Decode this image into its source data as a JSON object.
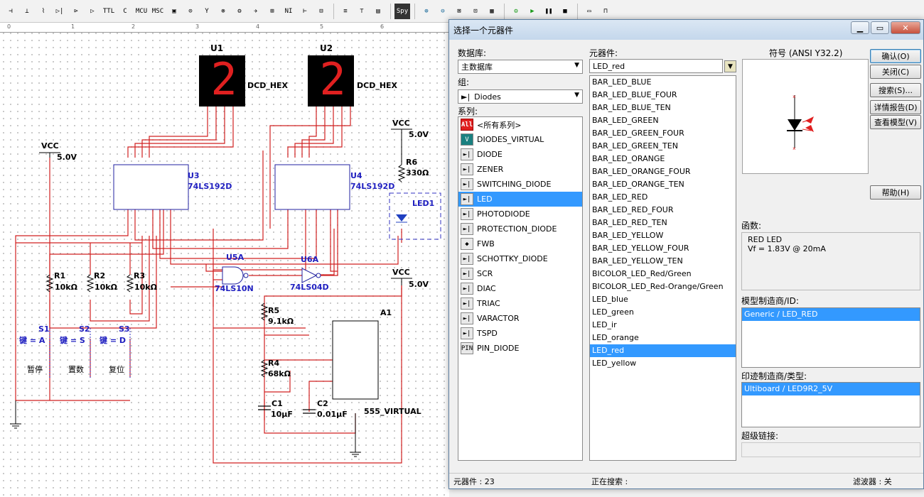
{
  "toolbar": {
    "icons": [
      "source-icon",
      "ground-icon",
      "resistor-icon",
      "diode-icon",
      "transistor-icon",
      "analog-icon",
      "ttl-icon",
      "cmos-icon",
      "mcu-icon",
      "misc-digital-icon",
      "mixed-icon",
      "indicator-icon",
      "power-icon",
      "misc-icon",
      "advanced-peripherals-icon",
      "rf-icon",
      "electromech-icon",
      "ni-component-icon",
      "connector-icon",
      "hier-block-icon",
      "bus-icon",
      "probe-icon",
      "spreadsheet-icon",
      "spy-icon",
      "zoom-in-icon",
      "zoom-out-icon",
      "zoom-area-icon",
      "zoom-fit-icon",
      "full-screen-icon",
      "run-icon",
      "play-icon",
      "pause-icon",
      "stop-icon",
      "probe-settings-icon",
      "toggle-icon"
    ],
    "spy_label": "Spy"
  },
  "schematic": {
    "u1_label": "U1",
    "u1_type": "DCD_HEX",
    "u2_label": "U2",
    "u2_type": "DCD_HEX",
    "u3_label": "U3",
    "u3_type": "74LS192D",
    "u4_label": "U4",
    "u4_type": "74LS192D",
    "u5_label": "U5A",
    "u5_type": "74LS10N",
    "u6_label": "U6A",
    "u6_type": "74LS04D",
    "a1_label": "A1",
    "a1_type": "555_VIRTUAL",
    "vcc": "VCC",
    "vcc_val": "5.0V",
    "r1": "R1",
    "r1_val": "10kΩ",
    "r2": "R2",
    "r2_val": "10kΩ",
    "r3": "R3",
    "r3_val": "10kΩ",
    "r4": "R4",
    "r4_val": "68kΩ",
    "r5": "R5",
    "r5_val": "9.1kΩ",
    "r6": "R6",
    "r6_val": "330Ω",
    "c1": "C1",
    "c1_val": "10μF",
    "c2": "C2",
    "c2_val": "0.01μF",
    "led1": "LED1",
    "s1": "S1",
    "s1_key": "键 = A",
    "s1_name": "暂停",
    "s2": "S2",
    "s2_key": "键 = S",
    "s2_name": "置数",
    "s3": "S3",
    "s3_key": "键 = D",
    "s3_name": "复位",
    "digit": "2"
  },
  "dialog": {
    "title": "选择一个元器件",
    "database_label": "数据库:",
    "database_value": "主数据库",
    "group_label": "组:",
    "group_value": "Diodes",
    "family_label": "系列:",
    "component_label": "元器件:",
    "component_input": "LED_red",
    "symbol_label": "符号 (ANSI Y32.2)",
    "families": [
      {
        "icon": "All",
        "label": "<所有系列>"
      },
      {
        "icon": "V",
        "label": "DIODES_VIRTUAL"
      },
      {
        "icon": "►|",
        "label": "DIODE"
      },
      {
        "icon": "►|",
        "label": "ZENER"
      },
      {
        "icon": "►|",
        "label": "SWITCHING_DIODE"
      },
      {
        "icon": "►|",
        "label": "LED"
      },
      {
        "icon": "►|",
        "label": "PHOTODIODE"
      },
      {
        "icon": "►|",
        "label": "PROTECTION_DIODE"
      },
      {
        "icon": "◆",
        "label": "FWB"
      },
      {
        "icon": "►|",
        "label": "SCHOTTKY_DIODE"
      },
      {
        "icon": "►|",
        "label": "SCR"
      },
      {
        "icon": "►|",
        "label": "DIAC"
      },
      {
        "icon": "►|",
        "label": "TRIAC"
      },
      {
        "icon": "►|",
        "label": "VARACTOR"
      },
      {
        "icon": "►|",
        "label": "TSPD"
      },
      {
        "icon": "PIN",
        "label": "PIN_DIODE"
      }
    ],
    "components": [
      "BAR_LED_BLUE",
      "BAR_LED_BLUE_FOUR",
      "BAR_LED_BLUE_TEN",
      "BAR_LED_GREEN",
      "BAR_LED_GREEN_FOUR",
      "BAR_LED_GREEN_TEN",
      "BAR_LED_ORANGE",
      "BAR_LED_ORANGE_FOUR",
      "BAR_LED_ORANGE_TEN",
      "BAR_LED_RED",
      "BAR_LED_RED_FOUR",
      "BAR_LED_RED_TEN",
      "BAR_LED_YELLOW",
      "BAR_LED_YELLOW_FOUR",
      "BAR_LED_YELLOW_TEN",
      "BICOLOR_LED_Red/Green",
      "BICOLOR_LED_Red-Orange/Green",
      "LED_blue",
      "LED_green",
      "LED_ir",
      "LED_orange",
      "LED_red",
      "LED_yellow"
    ],
    "buttons": {
      "ok": "确认(O)",
      "close": "关闭(C)",
      "search": "搜索(S)...",
      "detail": "详情报告(D)",
      "model": "查看模型(V)",
      "help": "帮助(H)"
    },
    "function_label": "函数:",
    "function_line1": "RED LED",
    "function_line2": "Vf = 1.83V @ 20mA",
    "model_label": "模型制造商/ID:",
    "model_value": "Generic / LED_RED",
    "footprint_label": "印迹制造商/类型:",
    "footprint_value": "Ultiboard / LED9R2_5V",
    "hyperlink_label": "超级链接:",
    "status_count": "元器件 : 23",
    "status_search": "正在搜索 :",
    "status_filter": "滤波器 : 关"
  }
}
